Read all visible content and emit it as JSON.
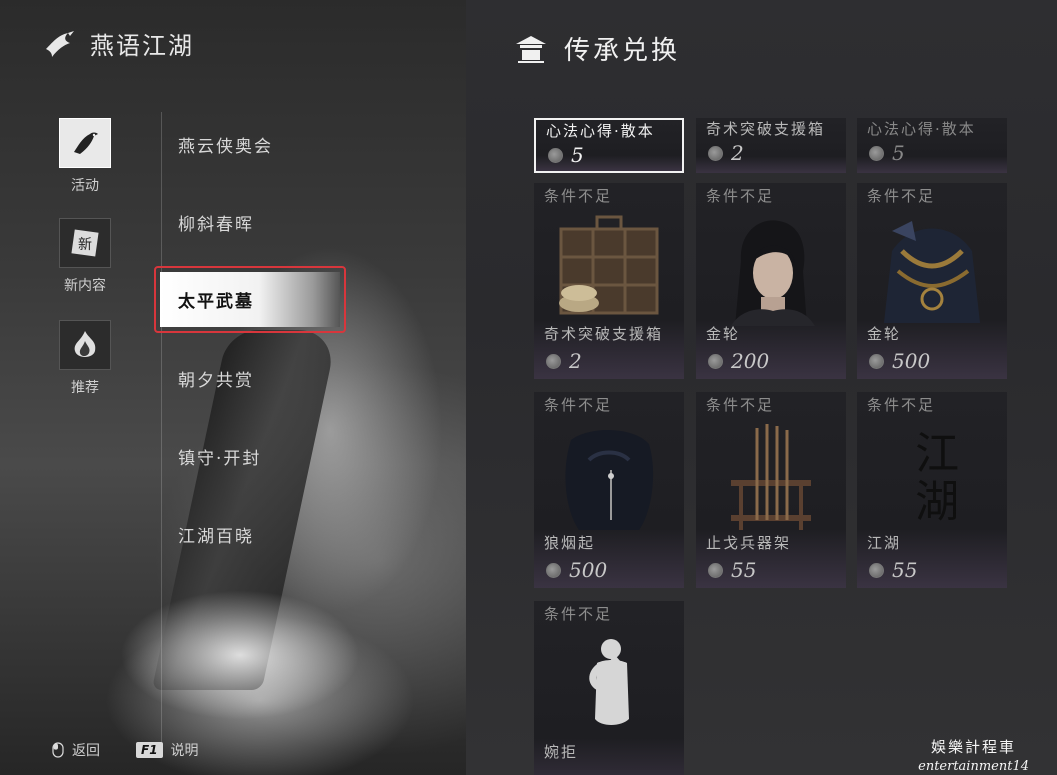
{
  "left": {
    "brand_title": "燕语江湖",
    "side_tabs": [
      {
        "label": "活动",
        "icon": "bird-icon",
        "active": true
      },
      {
        "label": "新内容",
        "icon": "new-seal-icon",
        "active": false
      },
      {
        "label": "推荐",
        "icon": "flame-icon",
        "active": false
      }
    ],
    "menu": [
      "燕云侠奥会",
      "柳斜春晖",
      "太平武墓",
      "朝夕共赏",
      "镇守·开封",
      "江湖百晓"
    ],
    "selected_menu_index": 2,
    "footer": {
      "back_label": "返回",
      "help_key": "F1",
      "help_label": "说明"
    }
  },
  "right": {
    "title": "传承兑换",
    "top_row": [
      {
        "name": "心法心得·散本",
        "price": "5",
        "selected": true
      },
      {
        "name": "奇术突破支援箱",
        "price": "2",
        "selected": false
      },
      {
        "name": "心法心得·散本",
        "price": "5",
        "selected": false
      }
    ],
    "items": [
      {
        "status": "条件不足",
        "name": "奇术突破支援箱",
        "price": "2",
        "art": "chest-icon"
      },
      {
        "status": "条件不足",
        "name": "金轮",
        "price": "200",
        "art": "character-portrait"
      },
      {
        "status": "条件不足",
        "name": "金轮",
        "price": "500",
        "art": "armor-icon"
      },
      {
        "status": "条件不足",
        "name": "狼烟起",
        "price": "500",
        "art": "hair-icon"
      },
      {
        "status": "条件不足",
        "name": "止戈兵器架",
        "price": "55",
        "art": "weapon-rack-icon"
      },
      {
        "status": "条件不足",
        "name": "江湖",
        "price": "55",
        "art": "calligraphy-icon"
      },
      {
        "status": "条件不足",
        "name": "婉拒",
        "price": "",
        "art": "pose-icon"
      }
    ],
    "calligraphy_text": "江湖"
  },
  "watermark": {
    "cn": "娛樂計程車",
    "en": "entertainment14"
  },
  "colors": {
    "selection_red": "#d8363c",
    "panel_bg": "#2b2b2e",
    "text_light": "#e8e8e8"
  }
}
